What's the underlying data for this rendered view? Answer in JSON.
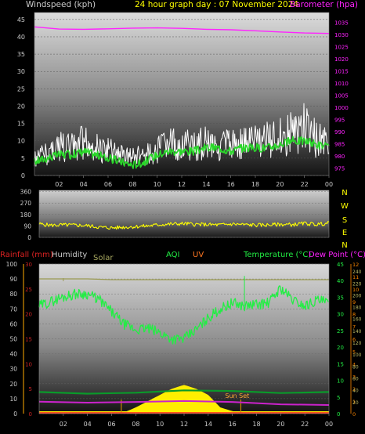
{
  "header": {
    "left_label": "Windspeed (kph)",
    "center_label": "24 hour graph day : 07 November 2024",
    "right_label": "Barometer (hpa)"
  },
  "colors": {
    "wind_gust": "#ffffff",
    "wind_avg": "#2ad82a",
    "barometer": "#ff22ff",
    "wind_dir": "#ffff00",
    "temperature": "#22ee44",
    "dew_point": "#cc22cc",
    "humidity_line": "#0a9a2a",
    "solar": "#9a9a52",
    "uv": "#ff7722",
    "rain": "#ff2222",
    "sun_fill": "#ffee00",
    "rain_axis": "#cc2222",
    "temp_axis": "#22ee44",
    "uv_axis": "#ff8800",
    "solar_axis": "#bbbb66"
  },
  "x_ticks": [
    "02",
    "04",
    "06",
    "08",
    "10",
    "12",
    "14",
    "16",
    "18",
    "20",
    "22",
    "00"
  ],
  "bottom_legend": {
    "rainfall": "Rainfall (mm)",
    "humidity": "Humidity",
    "solar": "Solar",
    "aqi": "AQI",
    "uv": "UV",
    "temperature": "Temperature (°C)",
    "dew_point": "Dew Point (°C)",
    "sun_set": "Sun Set"
  },
  "chart_data": [
    {
      "type": "line",
      "panel": "wind-barometer",
      "x_ticks": [
        "02",
        "04",
        "06",
        "08",
        "10",
        "12",
        "14",
        "16",
        "18",
        "20",
        "22",
        "00"
      ],
      "left_axis": {
        "label": "Windspeed (kph)",
        "range": [
          0,
          47
        ],
        "ticks": [
          0,
          5,
          10,
          15,
          20,
          25,
          30,
          35,
          40,
          45
        ]
      },
      "right_axis": {
        "label": "Barometer (hpa)",
        "range": [
          972,
          1039
        ],
        "ticks": [
          975,
          980,
          985,
          990,
          995,
          1000,
          1005,
          1010,
          1015,
          1020,
          1025,
          1030,
          1035
        ]
      },
      "series": [
        {
          "name": "Windspeed (kph)",
          "kind": "gust",
          "x": [
            0,
            1,
            2,
            3,
            4,
            5,
            6,
            7,
            8,
            9,
            10,
            11,
            12,
            13,
            14,
            15,
            16,
            17,
            18,
            19,
            20,
            21,
            22,
            23,
            24
          ],
          "y": [
            7,
            10,
            13,
            12,
            15,
            12,
            11,
            9,
            8,
            9,
            11,
            14,
            14,
            13,
            15,
            14,
            13,
            14,
            15,
            16,
            17,
            19,
            21,
            16,
            14
          ]
        },
        {
          "kind": "average",
          "x": [
            0,
            1,
            2,
            3,
            4,
            5,
            6,
            7,
            8,
            9,
            10,
            11,
            12,
            13,
            14,
            15,
            16,
            17,
            18,
            19,
            20,
            21,
            22,
            23,
            24
          ],
          "y": [
            4,
            5,
            6,
            6,
            7,
            6,
            5,
            4,
            3,
            4,
            6,
            7,
            7,
            7,
            8,
            8,
            7,
            8,
            8,
            8,
            9,
            10,
            10,
            9,
            8
          ]
        },
        {
          "name": "Barometer (hpa)",
          "x": [
            0,
            2,
            4,
            6,
            8,
            10,
            12,
            14,
            16,
            18,
            20,
            22,
            24
          ],
          "y": [
            1033.1,
            1032.2,
            1032.1,
            1032.3,
            1032.6,
            1032.7,
            1032.5,
            1032.1,
            1031.9,
            1031.5,
            1031.0,
            1030.6,
            1030.4
          ]
        }
      ]
    },
    {
      "type": "line",
      "panel": "wind-direction",
      "x_ticks": [
        "02",
        "04",
        "06",
        "08",
        "10",
        "12",
        "14",
        "16",
        "18",
        "20",
        "22",
        "00"
      ],
      "left_axis": {
        "range": [
          0,
          370
        ],
        "ticks": [
          0,
          90,
          180,
          270,
          360
        ]
      },
      "right_axis": {
        "ticks": [
          "N",
          "W",
          "S",
          "E",
          "N"
        ]
      },
      "series": [
        {
          "x": [
            0,
            1,
            2,
            3,
            4,
            5,
            6,
            7,
            8,
            9,
            10,
            11,
            12,
            13,
            14,
            15,
            16,
            17,
            18,
            19,
            20,
            21,
            22,
            23,
            24
          ],
          "y": [
            105,
            95,
            98,
            96,
            92,
            80,
            75,
            80,
            85,
            90,
            100,
            105,
            108,
            102,
            100,
            98,
            105,
            100,
            96,
            98,
            102,
            100,
            110,
            102,
            112
          ]
        }
      ]
    },
    {
      "type": "line",
      "panel": "temperature-humidity-rain",
      "x_ticks": [
        "02",
        "04",
        "06",
        "08",
        "10",
        "12",
        "14",
        "16",
        "18",
        "20",
        "22",
        "00"
      ],
      "left_axis": {
        "label": "Humidity",
        "range": [
          0,
          100
        ],
        "ticks": [
          0,
          10,
          20,
          30,
          40,
          50,
          60,
          70,
          80,
          90,
          100
        ]
      },
      "rain_axis": {
        "label": "Rainfall (mm)",
        "range": [
          0,
          30
        ],
        "ticks": [
          0,
          5,
          10,
          15,
          20,
          25,
          30
        ]
      },
      "temp_axis": {
        "label": "Temperature (°C)",
        "range": [
          0,
          45
        ],
        "ticks": [
          0,
          5,
          10,
          15,
          20,
          25,
          30,
          35,
          40,
          45
        ]
      },
      "uv_axis": {
        "label": "UV",
        "range": [
          0,
          12
        ],
        "ticks": [
          0,
          1,
          2,
          3,
          4,
          5,
          6,
          7,
          8,
          9,
          10,
          11,
          12
        ]
      },
      "solar_axis": {
        "label": "Solar",
        "ticks": [
          20,
          40,
          60,
          80,
          100,
          120,
          140,
          160,
          180,
          200,
          220,
          240
        ]
      },
      "series": [
        {
          "name": "Humidity",
          "x": [
            0,
            1,
            2,
            3,
            4,
            5,
            6,
            7,
            8,
            9,
            10,
            11,
            12,
            13,
            14,
            15,
            16,
            17,
            18,
            19,
            20,
            21,
            22,
            23,
            24
          ],
          "y": [
            72,
            75,
            78,
            80,
            80,
            76,
            68,
            60,
            56,
            57,
            54,
            50,
            50,
            56,
            64,
            70,
            74,
            72,
            73,
            74,
            84,
            76,
            72,
            76,
            74
          ]
        },
        {
          "name": "Temperature (°C)",
          "x": [
            0,
            4,
            8,
            12,
            16,
            20,
            24
          ],
          "y": [
            6.5,
            6.0,
            6.3,
            7.0,
            6.8,
            6.2,
            6.5
          ]
        },
        {
          "name": "Dew Point (°C)",
          "x": [
            0,
            4,
            8,
            12,
            16,
            20,
            24
          ],
          "y": [
            3.6,
            3.3,
            3.5,
            3.8,
            3.5,
            2.8,
            2.6
          ]
        },
        {
          "name": "Solar",
          "x": [
            0,
            2,
            4,
            6,
            8,
            10,
            12,
            14,
            16,
            18,
            20,
            22,
            24
          ],
          "y": [
            252,
            252,
            252,
            251,
            251,
            251,
            251,
            251,
            251,
            251,
            251,
            251,
            251
          ]
        },
        {
          "name": "Rainfall (mm)",
          "x": [
            0,
            24
          ],
          "y": [
            0,
            0
          ]
        },
        {
          "name": "UV",
          "x": [
            0,
            6.8,
            8,
            10,
            11,
            12,
            13,
            14,
            15,
            16,
            17,
            24
          ],
          "y": [
            0,
            0,
            0.5,
            1.5,
            2,
            2.3,
            2,
            1.5,
            0.5,
            0.2,
            0,
            0
          ]
        }
      ]
    }
  ]
}
